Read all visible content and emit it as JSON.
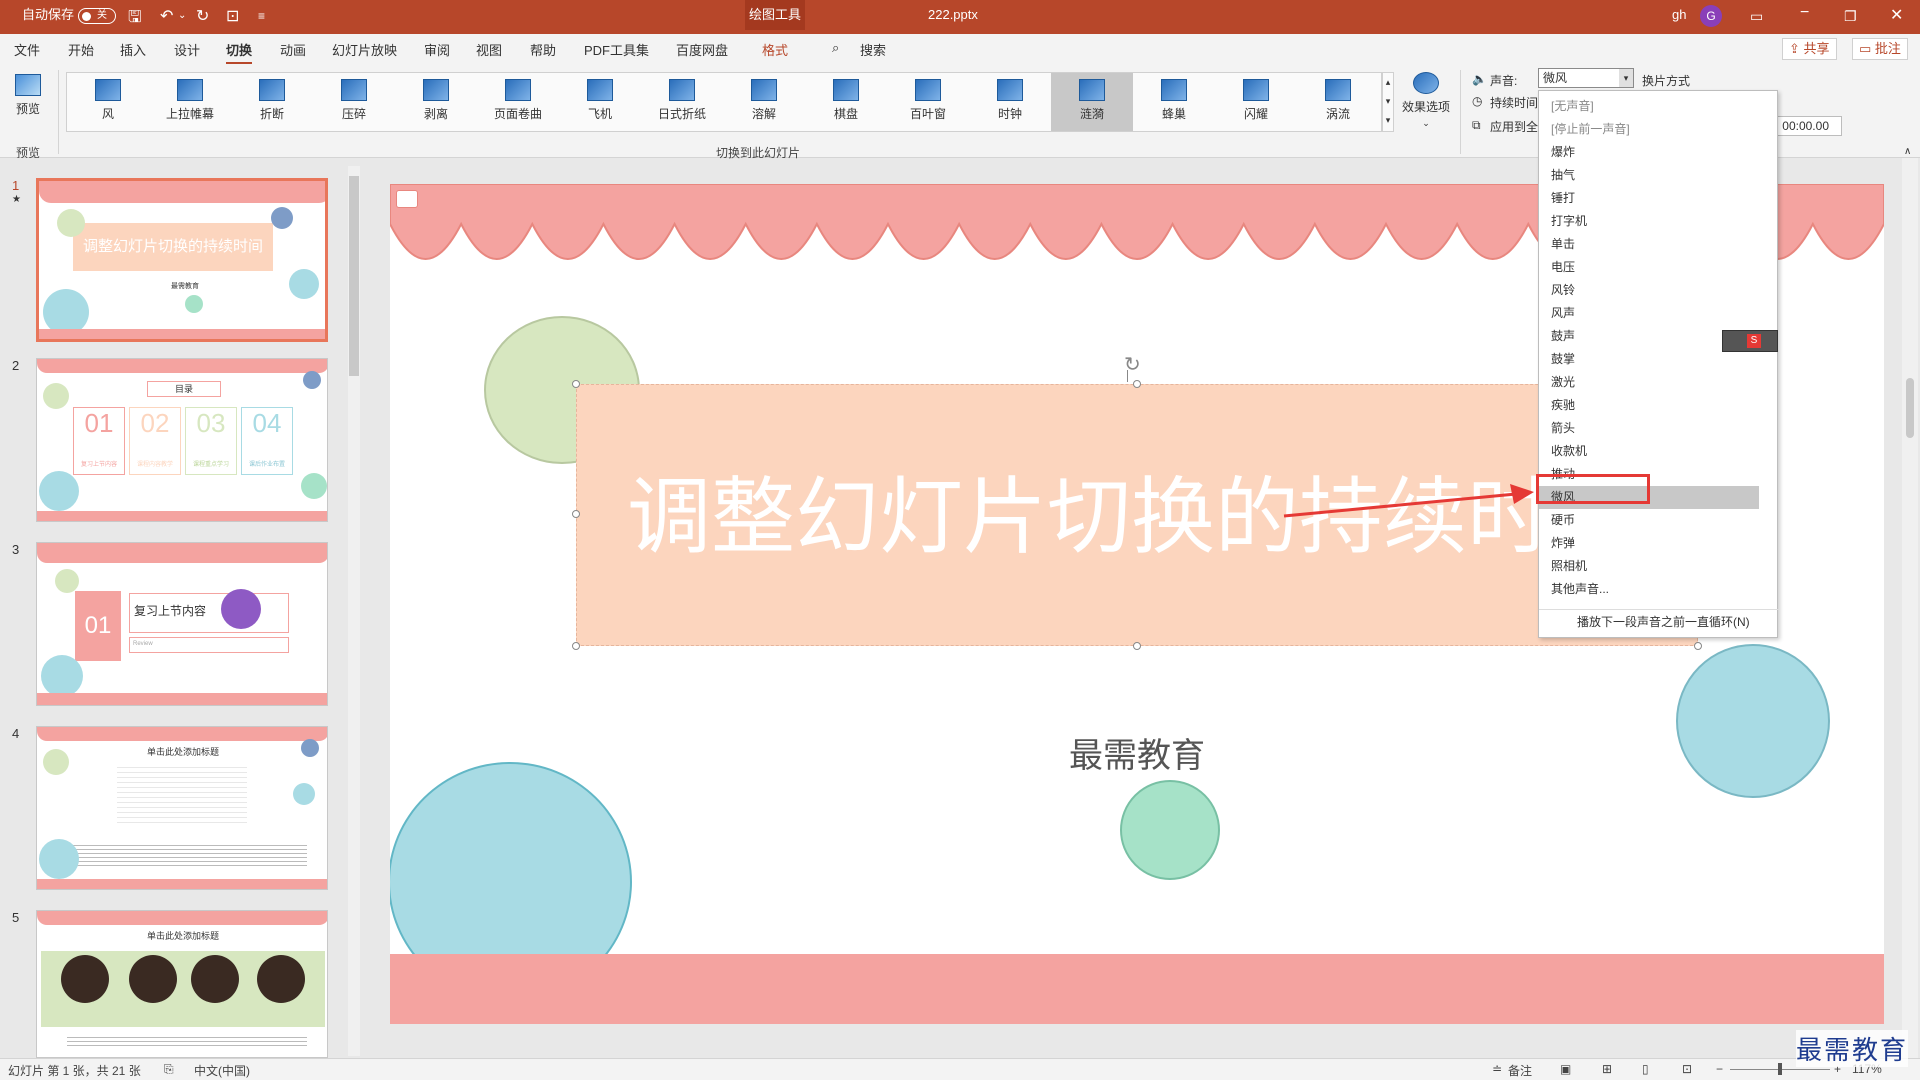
{
  "title_bar": {
    "autosave_label": "自动保存",
    "autosave_state": "关",
    "context_tab": "绘图工具",
    "file_name": "222.pptx",
    "user_initials": "gh",
    "avatar_letter": "G"
  },
  "menu": {
    "items": [
      "文件",
      "开始",
      "插入",
      "设计",
      "切换",
      "动画",
      "幻灯片放映",
      "审阅",
      "视图",
      "帮助",
      "PDF工具集",
      "百度网盘",
      "格式"
    ],
    "search_label": "搜索",
    "share_label": "共享",
    "comment_label": "批注"
  },
  "ribbon": {
    "preview_label": "预览",
    "preview_group_label": "预览",
    "transitions": [
      "风",
      "上拉帷幕",
      "折断",
      "压碎",
      "剥离",
      "页面卷曲",
      "飞机",
      "日式折纸",
      "溶解",
      "棋盘",
      "百叶窗",
      "时钟",
      "涟漪",
      "蜂巢",
      "闪耀",
      "涡流"
    ],
    "selected_transition": "涟漪",
    "transitions_group_label": "切换到此幻灯片",
    "effect_options_label": "效果选项",
    "sound_label": "声音:",
    "sound_value": "微风",
    "advance_label": "换片方式",
    "duration_label": "持续时间",
    "apply_all_label": "应用到全",
    "after_time_value": "00:00.00"
  },
  "sound_dropdown": {
    "items": [
      "[无声音]",
      "[停止前一声音]",
      "爆炸",
      "抽气",
      "锤打",
      "打字机",
      "单击",
      "电压",
      "风铃",
      "风声",
      "鼓声",
      "鼓掌",
      "激光",
      "疾驰",
      "箭头",
      "收款机",
      "推动",
      "微风",
      "硬币",
      "炸弹",
      "照相机",
      "其他声音..."
    ],
    "highlighted": "微风",
    "loop_label": "播放下一段声音之前一直循环(N)"
  },
  "slides": [
    {
      "number": "1",
      "title": "调整幻灯片切换的持续时间",
      "subtitle": "最需教育"
    },
    {
      "number": "2",
      "title": "目录",
      "nums": [
        "01",
        "02",
        "03",
        "04"
      ],
      "captions": [
        "复习上节内容",
        "课程内容教学",
        "课程重点学习",
        "课后作业布置"
      ]
    },
    {
      "number": "3",
      "num": "01",
      "title": "复习上节内容",
      "sub": "Review"
    },
    {
      "number": "4",
      "title": "单击此处添加标题"
    },
    {
      "number": "5",
      "title": "单击此处添加标题"
    }
  ],
  "main_slide": {
    "title": "调整幻灯片切换的持续时间",
    "subtitle": "最需教育"
  },
  "status": {
    "slide_info": "幻灯片 第 1 张，共 21 张",
    "language": "中文(中国)",
    "notes_label": "备注",
    "zoom": "117%"
  },
  "watermark": "最需教育",
  "colors": {
    "accent": "#b7472a",
    "pink": "#f4a3a0",
    "peach": "#fcd5be",
    "teal": "#a8dbe4",
    "green": "#d7e7c0",
    "mint": "#a6e2c8",
    "arrow": "#e53935"
  }
}
